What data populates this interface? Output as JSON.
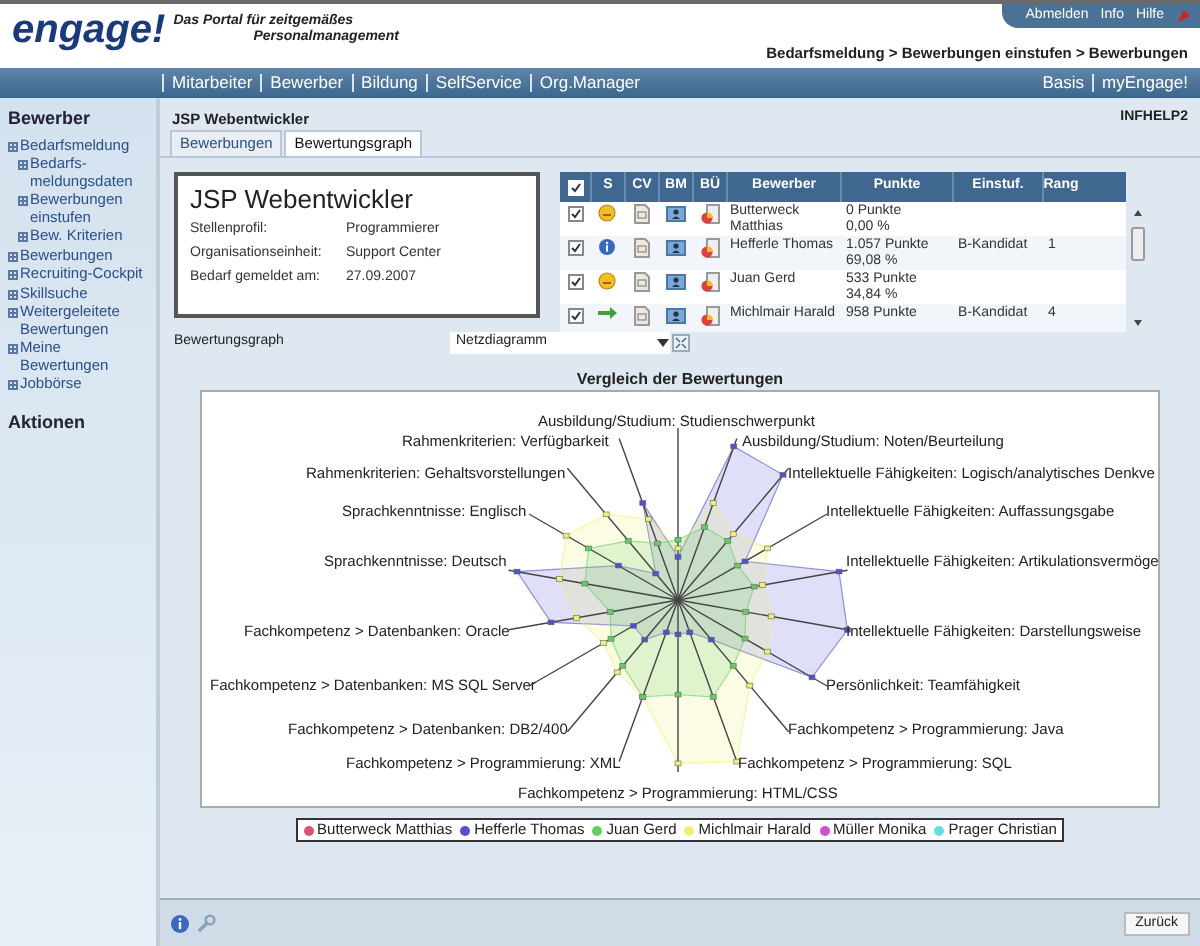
{
  "header": {
    "logo": "engage!",
    "tagline_1": "Das Portal für zeitgemäßes",
    "tagline_2": "Personalmanagement",
    "top_links": [
      "Abmelden",
      "Info",
      "Hilfe"
    ],
    "breadcrumb": "Bedarfsmeldung > Bewerbungen einstufen > Bewerbungen"
  },
  "nav": {
    "left": [
      "Mitarbeiter",
      "Bewerber",
      "Bildung",
      "SelfService",
      "Org.Manager"
    ],
    "right": [
      "Basis",
      "myEngage!"
    ]
  },
  "sidebar": {
    "title": "Bewerber",
    "items": [
      {
        "label": "Bedarfsmeldung",
        "children": [
          {
            "label": "Bedarfs-meldungsdaten"
          },
          {
            "label": "Bewerbungen einstufen"
          },
          {
            "label": "Bew. Kriterien"
          }
        ]
      },
      {
        "label": "Bewerbungen"
      },
      {
        "label": "Recruiting-Cockpit"
      },
      {
        "label": "Skillsuche"
      },
      {
        "label": "Weitergeleitete Bewertungen"
      },
      {
        "label": "Meine Bewertungen"
      },
      {
        "label": "Jobbörse"
      }
    ],
    "section": "Aktionen"
  },
  "page": {
    "title": "JSP Webentwickler",
    "code": "INFHELP2"
  },
  "tabs": [
    {
      "label": "Bewerbungen",
      "selected": false
    },
    {
      "label": "Bewertungsgraph",
      "selected": true
    }
  ],
  "info_card": {
    "title": "JSP Webentwickler",
    "fields": [
      {
        "label": "Stellenprofil:",
        "value": "Programmierer"
      },
      {
        "label": "Organisationseinheit:",
        "value": "Support Center"
      },
      {
        "label": "Bedarf gemeldet am:",
        "value": "27.09.2007"
      }
    ]
  },
  "table": {
    "header_checked": true,
    "columns": [
      "S",
      "CV",
      "BM",
      "BÜ",
      "Bewerber",
      "Punkte",
      "Einstuf.",
      "Rang"
    ],
    "rows": [
      {
        "checked": true,
        "kind": "smiley",
        "name": "Butterweck Matthias",
        "points": "0 Punkte",
        "percent": "0,00 %"
      },
      {
        "checked": true,
        "kind": "info",
        "name": "Hefferle Thomas",
        "points": "1.057 Punkte",
        "percent": "69,08 %",
        "grade": "B-Kandidat",
        "rank": "1"
      },
      {
        "checked": true,
        "kind": "smiley",
        "name": "Juan Gerd",
        "points": "533 Punkte",
        "percent": "34,84 %"
      },
      {
        "checked": true,
        "kind": "arrow",
        "name": "Michlmair Harald",
        "points": "958 Punkte",
        "grade": "B-Kandidat",
        "rank": "4"
      }
    ]
  },
  "graph_select": {
    "label": "Bewertungsgraph",
    "value": "Netzdiagramm"
  },
  "chart": {
    "title": "Vergleich der Bewertungen",
    "axes": [
      "Ausbildung/Studium: Studienschwerpunkt",
      "Rahmenkriterien: Verfügbarkeit",
      "Ausbildung/Studium: Noten/Beurteilung",
      "Rahmenkriterien: Gehaltsvorstellungen",
      "Intellektuelle Fähigkeiten: Logisch/analytisches Denkve",
      "Sprachkenntnisse: Englisch",
      "Intellektuelle Fähigkeiten: Auffassungsgabe",
      "Sprachkenntnisse: Deutsch",
      "Intellektuelle Fähigkeiten: Artikulationsvermöge",
      "Fachkompetenz > Datenbanken: Oracle",
      "Intellektuelle Fähigkeiten: Darstellungsweise",
      "Fachkompetenz > Datenbanken: MS SQL Server",
      "Persönlichkeit: Teamfähigkeit",
      "Fachkompetenz > Datenbanken: DB2/400",
      "Fachkompetenz > Programmierung: Java",
      "Fachkompetenz > Programmierung: XML",
      "Fachkompetenz > Programmierung: SQL",
      "Fachkompetenz > Programmierung: HTML/CSS"
    ],
    "legend": [
      {
        "name": "Butterweck Matthias",
        "color": "#e0506a"
      },
      {
        "name": "Hefferle Thomas",
        "color": "#5050d0"
      },
      {
        "name": "Juan Gerd",
        "color": "#60d060"
      },
      {
        "name": "Michlmair Harald",
        "color": "#f0f070"
      },
      {
        "name": "Müller Monika",
        "color": "#d050d0"
      },
      {
        "name": "Prager Christian",
        "color": "#60e0e0"
      }
    ]
  },
  "footer": {
    "button": "Zurück"
  }
}
